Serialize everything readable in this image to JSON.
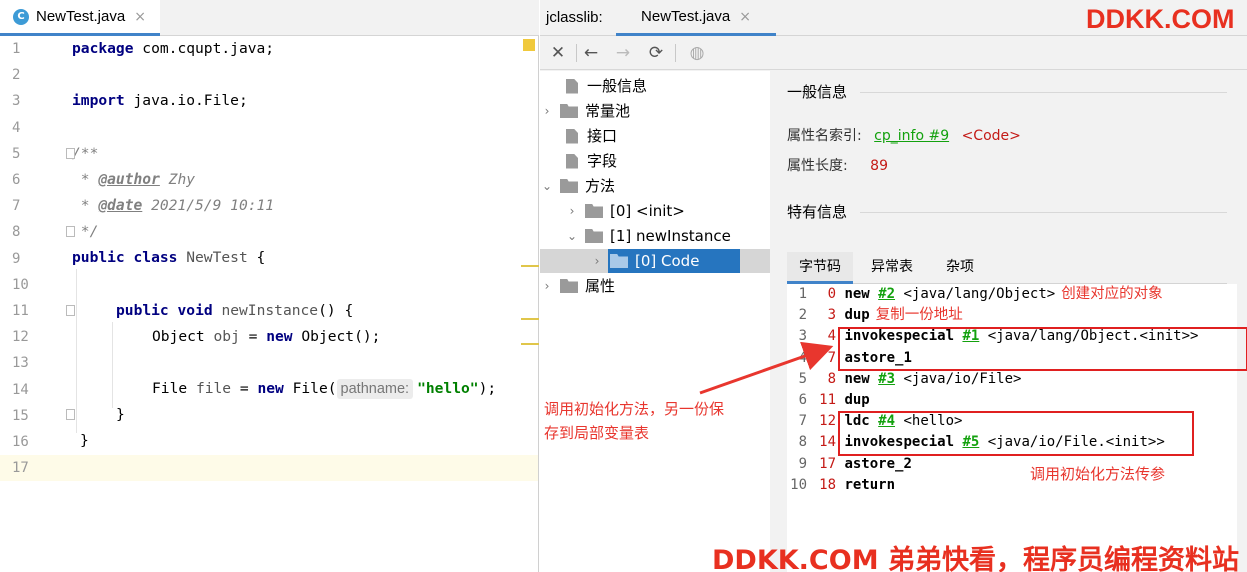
{
  "editor": {
    "tab": {
      "icon": "C",
      "label": "NewTest.java",
      "close": "×"
    },
    "line_numbers": [
      "1",
      "2",
      "3",
      "4",
      "5",
      "6",
      "7",
      "8",
      "9",
      "10",
      "11",
      "12",
      "13",
      "14",
      "15",
      "16",
      "17"
    ],
    "code": {
      "l1_kw": "package",
      "l1_rest": " com.cqupt.java;",
      "l3_kw": "import",
      "l3_rest": " java.io.File;",
      "l5": "/**",
      "l6_pre": " * ",
      "l6_tag": "@author",
      "l6_val": " Zhy",
      "l7_pre": " * ",
      "l7_tag": "@date",
      "l7_val": " 2021/5/9 10:11",
      "l8": " */",
      "l9_kw1": "public",
      "l9_kw2": " class",
      "l9_name": " NewTest",
      "l9_rest": " {",
      "l11_kw1": "public",
      "l11_kw2": " void",
      "l11_name": " newInstance",
      "l11_rest": "() {",
      "l12_type": "Object",
      "l12_var": " obj",
      "l12_eq": " = ",
      "l12_kw": "new",
      "l12_rest": " Object();",
      "l14_type": "File",
      "l14_var": " file",
      "l14_eq": " = ",
      "l14_kw": "new",
      "l14_call": " File(",
      "l14_hint": "pathname:",
      "l14_str": "\"hello\"",
      "l14_end": ");",
      "l15": "}",
      "l16": "}"
    }
  },
  "jclasslib": {
    "prefix": "jclasslib:",
    "tab": {
      "label": "NewTest.java",
      "close": "×"
    },
    "toolbar": {
      "close": "✕",
      "back": "←",
      "forward": "→",
      "refresh": "⟳",
      "web": "◍"
    },
    "tree": {
      "general": "一般信息",
      "constant_pool": "常量池",
      "interfaces": "接口",
      "fields": "字段",
      "methods": "方法",
      "init": "[0] <init>",
      "newinstance": "[1] newInstance",
      "code": "[0] Code",
      "attributes": "属性"
    },
    "details": {
      "general_title": "一般信息",
      "attr_name_label": "属性名索引:",
      "attr_name_link": "cp_info #9",
      "attr_name_value": "<Code>",
      "attr_len_label": "属性长度:",
      "attr_len_value": "89",
      "specific_title": "特有信息",
      "tabs": [
        "字节码",
        "异常表",
        "杂项"
      ]
    },
    "bytecode": [
      {
        "n": "1",
        "off": "0",
        "op": "new",
        "ref": "#2",
        "arg": " <java/lang/Object>",
        "note": "创建对应的对象"
      },
      {
        "n": "2",
        "off": "3",
        "op": "dup",
        "ref": "",
        "arg": "",
        "note": "复制一份地址"
      },
      {
        "n": "3",
        "off": "4",
        "op": "invokespecial",
        "ref": "#1",
        "arg": " <java/lang/Object.<init>>",
        "note": ""
      },
      {
        "n": "4",
        "off": "7",
        "op": "astore_1",
        "ref": "",
        "arg": "",
        "note": ""
      },
      {
        "n": "5",
        "off": "8",
        "op": "new",
        "ref": "#3",
        "arg": " <java/io/File>",
        "note": ""
      },
      {
        "n": "6",
        "off": "11",
        "op": "dup",
        "ref": "",
        "arg": "",
        "note": ""
      },
      {
        "n": "7",
        "off": "12",
        "op": "ldc",
        "ref": "#4",
        "arg": " <hello>",
        "note": ""
      },
      {
        "n": "8",
        "off": "14",
        "op": "invokespecial",
        "ref": "#5",
        "arg": " <java/io/File.<init>>",
        "note": ""
      },
      {
        "n": "9",
        "off": "17",
        "op": "astore_2",
        "ref": "",
        "arg": "",
        "note": ""
      },
      {
        "n": "10",
        "off": "18",
        "op": "return",
        "ref": "",
        "arg": "",
        "note": ""
      }
    ]
  },
  "annotations": {
    "left_note": "调用初始化方法，另一份保存到局部变量表",
    "right_note": "调用初始化方法传参"
  },
  "watermarks": {
    "top": "DDKK.COM",
    "bottom": "DDKK.COM 弟弟快看，程序员编程资料站"
  }
}
